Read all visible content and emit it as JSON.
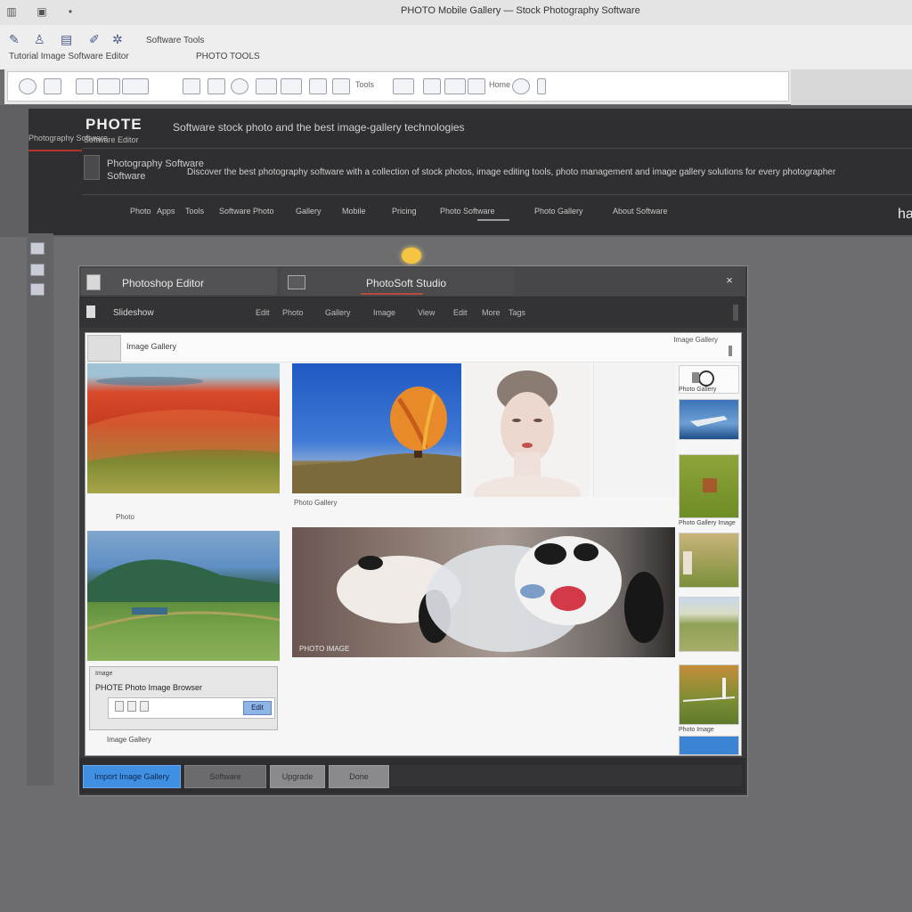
{
  "app": {
    "window_title": "PHOTO Mobile Gallery — Stock Photography Software",
    "ribbon_label_1": "Tutorial Image Software Editor",
    "ribbon_label_2": "PHOTO TOOLS",
    "ribbon_label_3": "Software Tools"
  },
  "toolbar": {
    "text_1": "Tools",
    "text_2": "Home"
  },
  "header": {
    "logo": "PHOTE",
    "url": "Software stock photo and the best image-gallery technologies",
    "side_label_1": "Photography Software",
    "side_label_2": "Software Editor",
    "line_1": "Photography Software",
    "line_2": "Software",
    "description": "Discover the best photography software with a collection of stock photos, image editing tools, photo management and image gallery solutions for every photographer",
    "nav": [
      "Photo",
      "Apps",
      "Tools",
      "Software Photo",
      "Gallery",
      "Mobile",
      "Pricing",
      "Photo Software",
      "Photo Gallery",
      "About Software"
    ],
    "cut_text": "ha"
  },
  "dialog": {
    "tab_1": "Photoshop Editor",
    "tab_2": "PhotoSoft Studio",
    "close": "×",
    "toolbar_label": "Slideshow",
    "toolbar_items": [
      "Edit",
      "Photo",
      "Gallery",
      "Image",
      "View",
      "Edit",
      "More",
      "Tags"
    ]
  },
  "content": {
    "header_label": "Image Gallery",
    "header_right": "Image Gallery",
    "caption_row2_left": "Photo",
    "caption_row2_mid": "Photo Gallery",
    "caption_dog": "PHOTO IMAGE",
    "thumb_cap_1": "Photo Gallery",
    "thumb_cap_2": "Photo Gallery Image",
    "thumb_cap_3": "Photo Image"
  },
  "subwindow": {
    "title": "Image",
    "line": "PHOTE Photo Image Browser",
    "button": "Edit",
    "below": "Image Gallery"
  },
  "footer": {
    "btn_primary": "Import Image Gallery",
    "btn_2": "Software",
    "btn_3": "Upgrade",
    "btn_4": "Done"
  },
  "colors": {
    "primary_button": "#3f8fe3",
    "accent_red": "#b4342a",
    "bulb": "#f5c542"
  }
}
